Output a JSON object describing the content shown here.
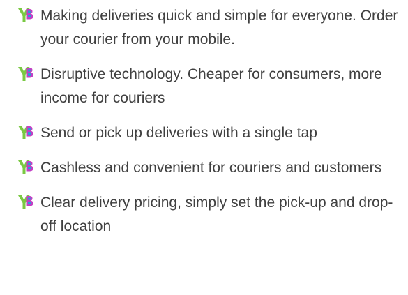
{
  "features": {
    "items": [
      {
        "text": "Making deliveries quick and simple for everyone. Order your courier from your mobile.",
        "icon": "yb-logo-icon"
      },
      {
        "text": "Disruptive technology. Cheaper for consumers, more income for couriers",
        "icon": "yb-logo-icon"
      },
      {
        "text": "Send or pick up deliveries with a single tap",
        "icon": "yb-logo-icon"
      },
      {
        "text": "Cashless and convenient for couriers and customers",
        "icon": "yb-logo-icon"
      },
      {
        "text": "Clear delivery pricing, simply set the pick-up and drop-off location",
        "icon": "yb-logo-icon"
      }
    ],
    "colors": {
      "text": "#404040",
      "logo_y": "#7ac943",
      "logo_b": "#c23ec4",
      "logo_b_inner": "#2e9bd6"
    }
  }
}
